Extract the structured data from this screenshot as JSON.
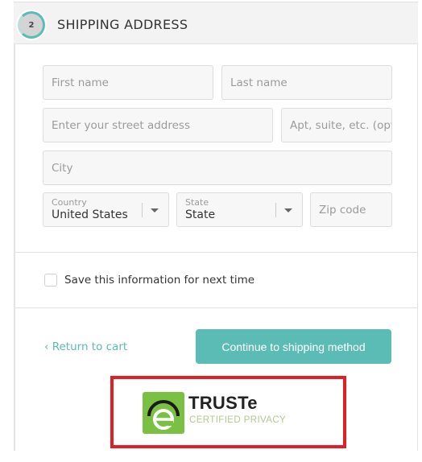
{
  "header": {
    "step_number": "2",
    "title": "SHIPPING ADDRESS"
  },
  "form": {
    "first_name": {
      "placeholder": "First name",
      "value": ""
    },
    "last_name": {
      "placeholder": "Last name",
      "value": ""
    },
    "street": {
      "placeholder": "Enter your street address",
      "value": ""
    },
    "apt": {
      "placeholder": "Apt, suite, etc. (optional)",
      "visible_text": "Apt, suite, etc. (opt",
      "value": ""
    },
    "city": {
      "placeholder": "City",
      "value": ""
    },
    "country": {
      "label": "Country",
      "selected": "United States"
    },
    "state": {
      "label": "State",
      "selected": "State"
    },
    "zip": {
      "placeholder": "Zip code",
      "value": ""
    }
  },
  "save_info": {
    "label": "Save this information for next time",
    "checked": false
  },
  "actions": {
    "return_label": "Return to cart",
    "return_icon": "chevron-left-icon",
    "continue_label": "Continue to shipping method"
  },
  "badge": {
    "name": "TRUSTe",
    "subtitle": "CERTIFIED PRIVACY",
    "highlight_color": "#e31e24",
    "logo_color": "#7ac143"
  },
  "colors": {
    "accent": "#5bbbb5",
    "header_bg": "#f3f3f3"
  }
}
